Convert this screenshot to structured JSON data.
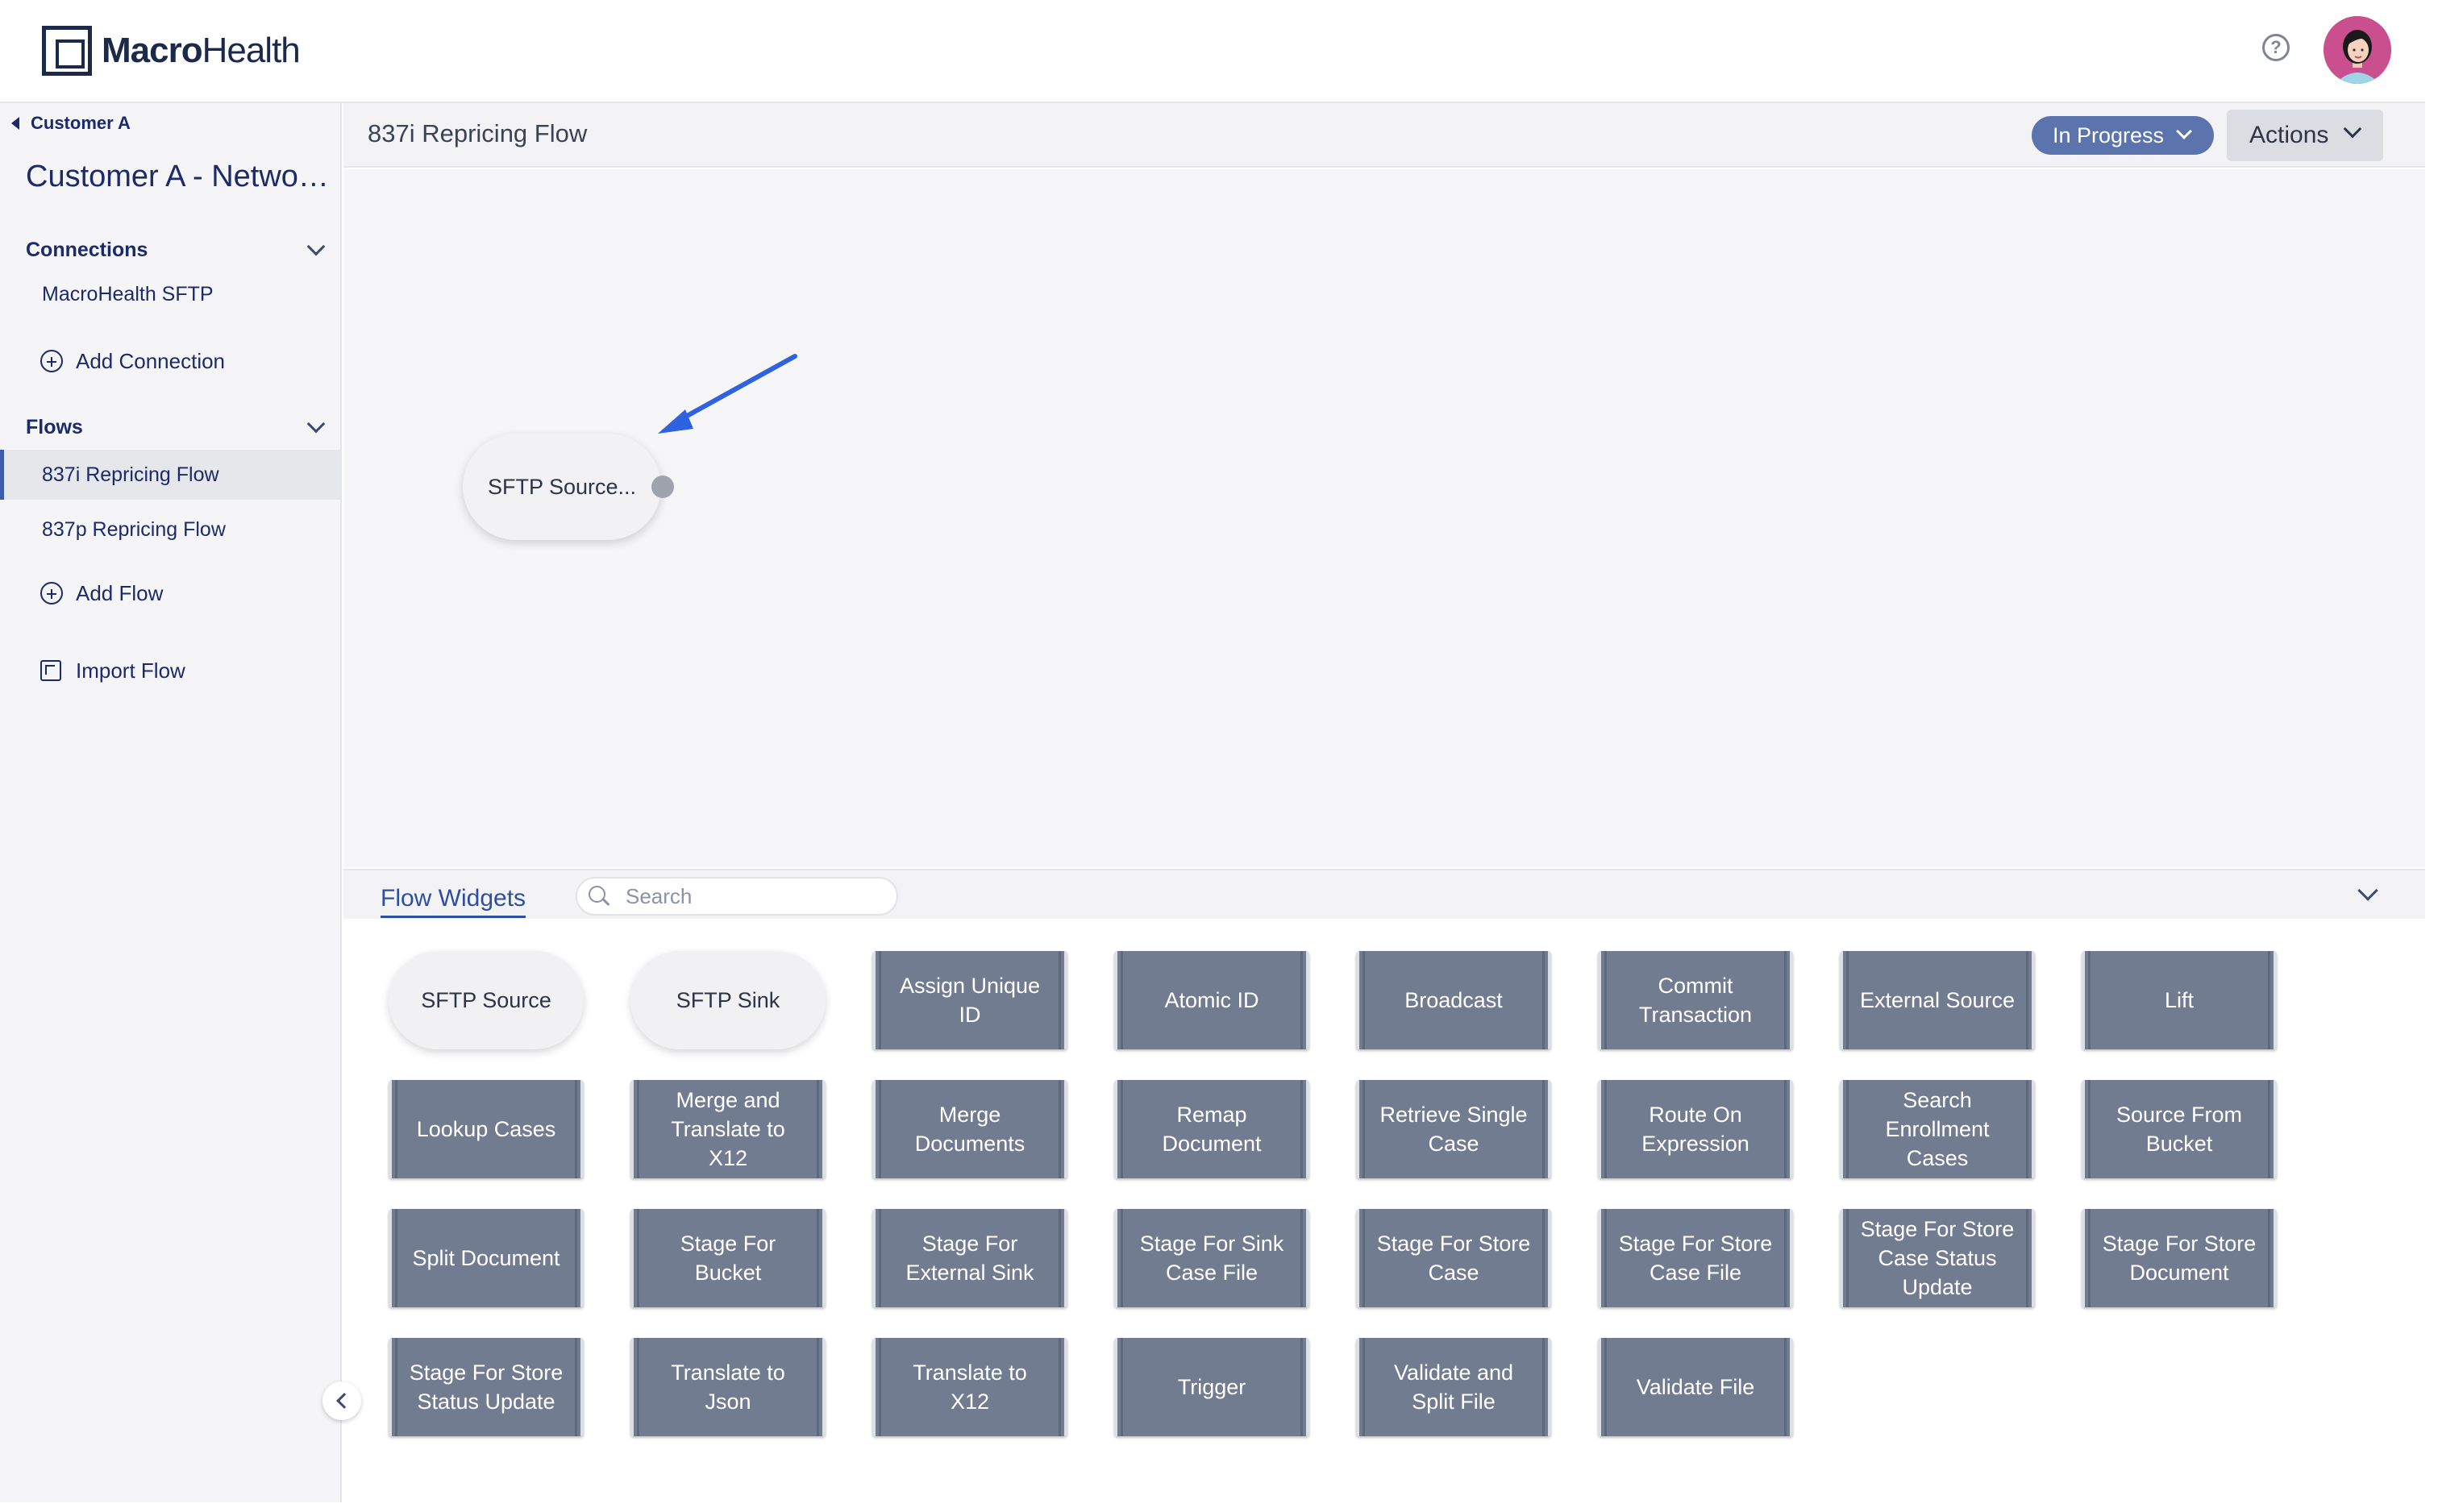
{
  "brand": {
    "logo_bold": "Macro",
    "logo_light": "Health"
  },
  "header": {
    "help_glyph": "?"
  },
  "sidebar": {
    "back_label": "Customer A",
    "customer_title": "Customer A - Network Services",
    "connections": {
      "heading": "Connections",
      "items": [
        "MacroHealth SFTP"
      ],
      "add_label": "Add Connection"
    },
    "flows": {
      "heading": "Flows",
      "items": [
        "837i Repricing Flow",
        "837p Repricing Flow"
      ],
      "active_index": 0,
      "add_label": "Add Flow",
      "import_label": "Import Flow"
    }
  },
  "main": {
    "flow_title": "837i Repricing Flow",
    "status_label": "In Progress",
    "actions_label": "Actions",
    "status_color": "#5b74ad"
  },
  "canvas": {
    "node_label": "SFTP Source...",
    "arrow_color": "#2f62e0"
  },
  "widgets": {
    "tab_label": "Flow Widgets",
    "search_placeholder": "Search",
    "items": [
      {
        "label": "SFTP Source",
        "kind": "pill"
      },
      {
        "label": "SFTP Sink",
        "kind": "pill"
      },
      {
        "label": "Assign Unique ID",
        "kind": "rect"
      },
      {
        "label": "Atomic ID",
        "kind": "rect"
      },
      {
        "label": "Broadcast",
        "kind": "rect"
      },
      {
        "label": "Commit Transaction",
        "kind": "rect"
      },
      {
        "label": "External Source",
        "kind": "rect"
      },
      {
        "label": "Lift",
        "kind": "rect"
      },
      {
        "label": "Lookup Cases",
        "kind": "rect"
      },
      {
        "label": "Merge and Translate to X12",
        "kind": "rect"
      },
      {
        "label": "Merge Documents",
        "kind": "rect"
      },
      {
        "label": "Remap Document",
        "kind": "rect"
      },
      {
        "label": "Retrieve Single Case",
        "kind": "rect"
      },
      {
        "label": "Route On Expression",
        "kind": "rect"
      },
      {
        "label": "Search Enrollment Cases",
        "kind": "rect"
      },
      {
        "label": "Source From Bucket",
        "kind": "rect"
      },
      {
        "label": "Split Document",
        "kind": "rect"
      },
      {
        "label": "Stage For Bucket",
        "kind": "rect"
      },
      {
        "label": "Stage For External Sink",
        "kind": "rect"
      },
      {
        "label": "Stage For Sink Case File",
        "kind": "rect"
      },
      {
        "label": "Stage For Store Case",
        "kind": "rect"
      },
      {
        "label": "Stage For Store Case File",
        "kind": "rect"
      },
      {
        "label": "Stage For Store Case Status Update",
        "kind": "rect"
      },
      {
        "label": "Stage For Store Document",
        "kind": "rect"
      },
      {
        "label": "Stage For Store Status Update",
        "kind": "rect"
      },
      {
        "label": "Translate to Json",
        "kind": "rect"
      },
      {
        "label": "Translate to X12",
        "kind": "rect"
      },
      {
        "label": "Trigger",
        "kind": "rect"
      },
      {
        "label": "Validate and Split File",
        "kind": "rect"
      },
      {
        "label": "Validate File",
        "kind": "rect"
      }
    ]
  }
}
